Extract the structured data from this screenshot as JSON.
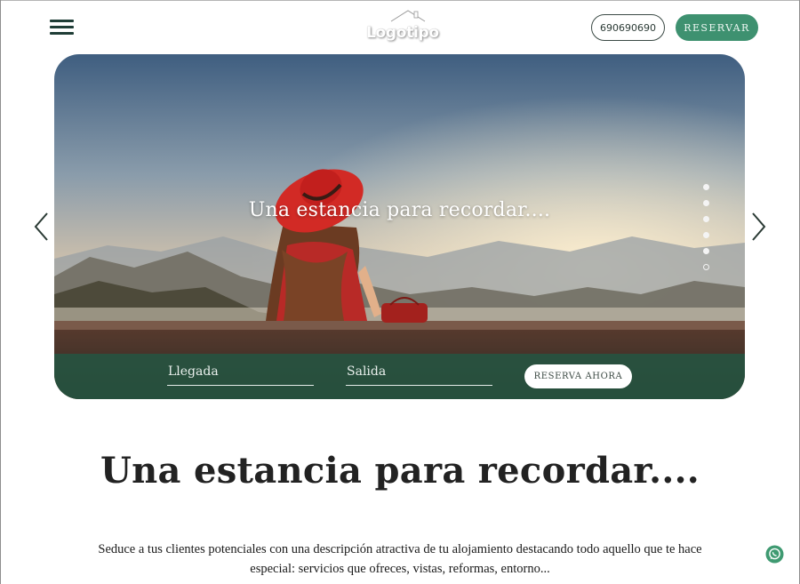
{
  "header": {
    "menu_icon": "hamburger-menu-icon",
    "logo_text": "Logotipo",
    "logo_icon": "house-roof-icon",
    "phone_label": "690690690",
    "reserve_label": "RESERVAR",
    "accent_color": "#3e9170"
  },
  "hero": {
    "slide_title": "Una estancia para recordar....",
    "prev_icon": "chevron-left-icon",
    "next_icon": "chevron-right-icon",
    "slide_count": 6,
    "active_slide": 6,
    "image_description": "woman-red-hat-mountains-sunset",
    "booking": {
      "arrival_placeholder": "Llegada",
      "departure_placeholder": "Salida",
      "book_now_label": "RESERVA AHORA",
      "bar_color": "#265441"
    }
  },
  "content": {
    "title": "Una estancia para recordar....",
    "description_line1": "Seduce a tus clientes potenciales con una descripción atractiva de tu alojamiento destacando todo aquello que te hace",
    "description_line2": "especial: servicios que ofreces, vistas, reformas, entorno..."
  },
  "floating": {
    "whatsapp_icon": "whatsapp-icon"
  }
}
